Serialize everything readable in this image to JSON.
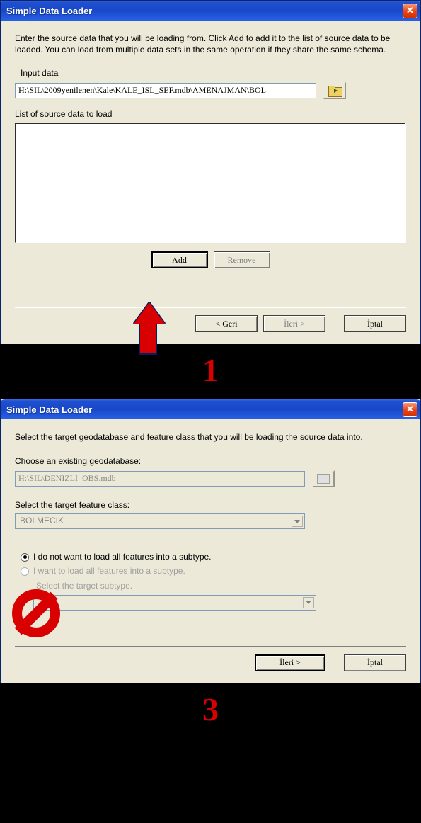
{
  "dialog1": {
    "title": "Simple Data Loader",
    "description": "Enter the source data that you will be loading from. Click Add to add it to the list of source data to be loaded. You can load from multiple data sets in the same operation if they share the same schema.",
    "input_label": "Input data",
    "input_value": "H:\\SIL\\2009yenilenen\\Kale\\KALE_ISL_SEF.mdb\\AMENAJMAN\\BOL",
    "list_label": "List of source data to load",
    "add_label": "Add",
    "remove_label": "Remove",
    "back_label": "< Geri",
    "next_label": "İleri >",
    "cancel_label": "İptal"
  },
  "step1_num": "1",
  "dialog2": {
    "title": "Simple Data Loader",
    "description": "Select the target geodatabase and feature class that you will be loading the source data into.",
    "gdb_label": "Choose an existing geodatabase:",
    "gdb_value": "H:\\SIL\\DENIZLI_OBS.mdb",
    "fc_label": "Select the target feature class:",
    "fc_value": "BOLMECIK",
    "radio1": "I do not want to load all features into a subtype.",
    "radio2": "I want to load all features into a subtype.",
    "subtype_label": "Select the target subtype.",
    "next_label": "İleri >",
    "cancel_label": "İptal"
  },
  "step3_num": "3"
}
